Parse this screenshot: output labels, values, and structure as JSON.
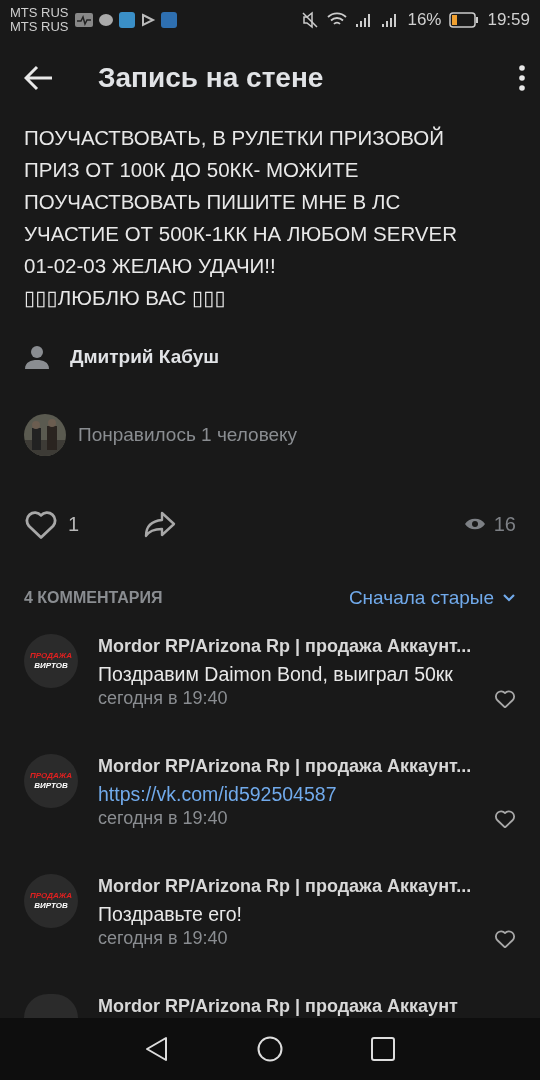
{
  "status_bar": {
    "carriers": [
      "MTS RUS",
      "MTS RUS"
    ],
    "battery": "16%",
    "time": "19:59"
  },
  "header": {
    "title": "Запись на стене"
  },
  "post": {
    "lines": [
      "ПОУЧАСТВОВАТЬ, В РУЛЕТКИ ПРИЗОВОЙ",
      "ПРИЗ ОТ 100К ДО 50КК- МОЖИТЕ",
      "ПОУЧАСТВОВАТЬ ПИШИТЕ МНЕ В ЛС",
      "УЧАСТИЕ ОТ 500К-1КК НА ЛЮБОМ SERVER",
      "01-02-03 ЖЕЛАЮ УДАЧИ!!",
      "▯▯▯ЛЮБЛЮ ВАС ▯▯▯"
    ],
    "author": "Дмитрий Кабуш",
    "liked_by": "Понравилось 1 человеку",
    "likes": "1",
    "liked": false,
    "views": "16"
  },
  "comments_header": {
    "count": "4 КОММЕНТАРИЯ",
    "sort": "Сначала старые"
  },
  "comments": [
    {
      "author": "Mordor RP/Arizona Rp | продажа Аккаунт...",
      "avatar_text": [
        "ПРОДАЖА",
        "ВИРТОВ"
      ],
      "text": "Поздравим Daimon Bond,  выиграл 50кк",
      "kind": "text",
      "time": "сегодня в 19:40",
      "liked": false
    },
    {
      "author": "Mordor RP/Arizona Rp | продажа Аккаунт...",
      "avatar_text": [
        "ПРОДАЖА",
        "ВИРТОВ"
      ],
      "text": "https://vk.com/id592504587",
      "kind": "link",
      "time": "сегодня в 19:40",
      "liked": false
    },
    {
      "author": "Mordor RP/Arizona Rp | продажа Аккаунт...",
      "avatar_text": [
        "ПРОДАЖА",
        "ВИРТОВ"
      ],
      "text": "Поздравьте его!",
      "kind": "text",
      "time": "сегодня в 19:40",
      "liked": false
    },
    {
      "author": "Mordor RP/Arizona Rp | продажа Аккаунт",
      "kind": "partial"
    }
  ]
}
